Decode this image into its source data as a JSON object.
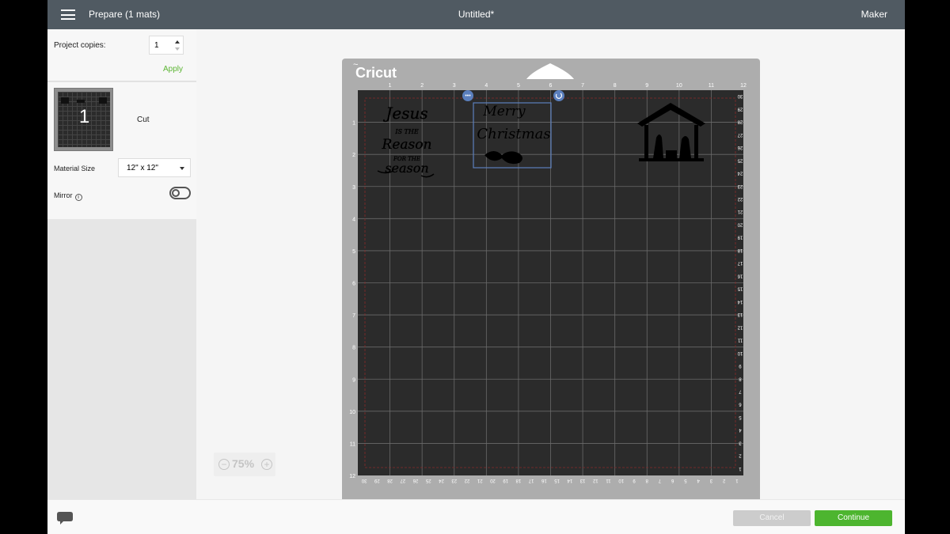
{
  "header": {
    "menu_icon": "hamburger-menu-icon",
    "title": "Prepare (1 mats)",
    "document": "Untitled*",
    "machine": "Maker"
  },
  "sidebar": {
    "copies_label": "Project copies:",
    "copies_value": "1",
    "apply_label": "Apply",
    "mat": {
      "number": "1",
      "mode": "Cut"
    },
    "material_size_label": "Material Size",
    "material_size_value": "12\" x 12\"",
    "mirror_label": "Mirror",
    "mirror_on": false
  },
  "mat": {
    "brand": "Cricut",
    "top_ruler": [
      "1",
      "2",
      "3",
      "4",
      "5",
      "6",
      "7",
      "8",
      "9",
      "10",
      "11",
      "12"
    ],
    "left_ruler": [
      "1",
      "2",
      "3",
      "4",
      "5",
      "6",
      "7",
      "8",
      "9",
      "10",
      "11",
      "12"
    ],
    "bottom_ruler": [
      "30",
      "29",
      "28",
      "27",
      "26",
      "25",
      "24",
      "23",
      "22",
      "21",
      "20",
      "19",
      "18",
      "17",
      "16",
      "15",
      "14",
      "13",
      "12",
      "11",
      "10",
      "9",
      "8",
      "7",
      "6",
      "5",
      "4",
      "3",
      "2",
      "1"
    ],
    "right_ruler": [
      "30",
      "29",
      "28",
      "27",
      "26",
      "25",
      "24",
      "23",
      "22",
      "21",
      "20",
      "19",
      "18",
      "17",
      "16",
      "15",
      "14",
      "13",
      "12",
      "11",
      "10",
      "9",
      "8",
      "7",
      "6",
      "5",
      "4",
      "3",
      "2",
      "1"
    ],
    "designs": [
      {
        "name": "jesus-reason-design",
        "lines": [
          "Jesus",
          "IS THE",
          "Reason",
          "FOR THE",
          "season"
        ]
      },
      {
        "name": "merry-christmas-design",
        "lines": [
          "Merry",
          "Christmas"
        ],
        "selected": true
      },
      {
        "name": "nativity-design",
        "icon": "nativity-scene-icon"
      }
    ],
    "selection_handles": {
      "menu": "more-options-icon",
      "rotate": "rotate-icon"
    }
  },
  "zoom": {
    "value": "75%",
    "minus": "−",
    "plus": "+"
  },
  "footer": {
    "chat_icon": "chat-bubble-icon",
    "cancel": "Cancel",
    "continue": "Continue"
  },
  "colors": {
    "topbar": "#505a62",
    "accent": "#4db52f",
    "mat": "#adadad",
    "grid": "#2b2b2b",
    "selection": "#5b7fbd"
  }
}
